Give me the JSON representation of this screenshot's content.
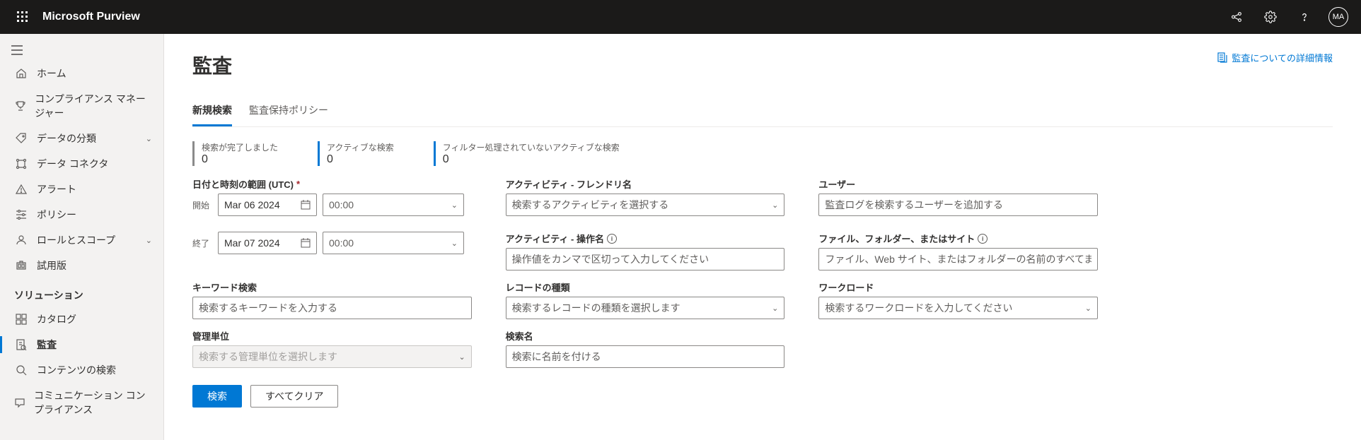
{
  "header": {
    "brand": "Microsoft Purview",
    "avatar": "MA"
  },
  "sidebar": {
    "items": [
      {
        "icon": "home",
        "label": "ホーム"
      },
      {
        "icon": "trophy",
        "label": "コンプライアンス マネージャー"
      },
      {
        "icon": "tag",
        "label": "データの分類",
        "expandable": true
      },
      {
        "icon": "connector",
        "label": "データ コネクタ"
      },
      {
        "icon": "alert",
        "label": "アラート"
      },
      {
        "icon": "policy",
        "label": "ポリシー"
      },
      {
        "icon": "roles",
        "label": "ロールとスコープ",
        "expandable": true
      },
      {
        "icon": "trial",
        "label": "試用版"
      }
    ],
    "section": "ソリューション",
    "solutions": [
      {
        "icon": "catalog",
        "label": "カタログ"
      },
      {
        "icon": "audit",
        "label": "監査",
        "active": true
      },
      {
        "icon": "search",
        "label": "コンテンツの検索"
      },
      {
        "icon": "comm",
        "label": "コミュニケーション コンプライアンス"
      }
    ]
  },
  "page": {
    "title": "監査",
    "learn_more": "監査についての詳細情報",
    "tabs": [
      {
        "label": "新規検索",
        "active": true
      },
      {
        "label": "監査保持ポリシー"
      }
    ],
    "stats": [
      {
        "label": "検索が完了しました",
        "value": "0",
        "color": "gray"
      },
      {
        "label": "アクティブな検索",
        "value": "0",
        "color": "blue"
      },
      {
        "label": "フィルター処理されていないアクティブな検索",
        "value": "0",
        "color": "blue"
      }
    ],
    "form": {
      "date_range_label": "日付と時刻の範囲 (UTC)",
      "start_label": "開始",
      "end_label": "終了",
      "start_date": "Mar 06 2024",
      "start_time": "00:00",
      "end_date": "Mar 07 2024",
      "end_time": "00:00",
      "keyword_label": "キーワード検索",
      "keyword_placeholder": "検索するキーワードを入力する",
      "admin_unit_label": "管理単位",
      "admin_unit_placeholder": "検索する管理単位を選択します",
      "activity_friendly_label": "アクティビティ - フレンドリ名",
      "activity_friendly_placeholder": "検索するアクティビティを選択する",
      "activity_op_label": "アクティビティ - 操作名",
      "activity_op_placeholder": "操作値をカンマで区切って入力してください",
      "record_type_label": "レコードの種類",
      "record_type_placeholder": "検索するレコードの種類を選択します",
      "search_name_label": "検索名",
      "search_name_placeholder": "検索に名前を付ける",
      "users_label": "ユーザー",
      "users_placeholder": "監査ログを検索するユーザーを追加する",
      "file_label": "ファイル、フォルダー、またはサイト",
      "file_placeholder": "ファイル、Web サイト、またはフォルダーの名前のすべてまたは一部を入力してください",
      "workload_label": "ワークロード",
      "workload_placeholder": "検索するワークロードを入力してください",
      "search_btn": "検索",
      "clear_btn": "すべてクリア"
    }
  }
}
